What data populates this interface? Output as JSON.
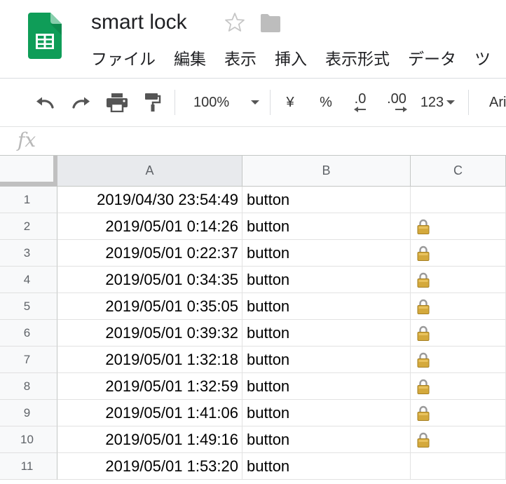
{
  "doc": {
    "title": "smart lock"
  },
  "header_icons": {
    "app": "google-sheets-icon",
    "star": "star-outline-icon",
    "folder": "folder-icon"
  },
  "menu": [
    "ファイル",
    "編集",
    "表示",
    "挿入",
    "表示形式",
    "データ",
    "ツ"
  ],
  "toolbar": {
    "zoom": "100%",
    "currency": "¥",
    "percent": "%",
    "decrease_decimal": ".0",
    "increase_decimal": ".00",
    "number_format": "123",
    "font": "Ari"
  },
  "formula_bar": {
    "fx_label": "fx",
    "value": ""
  },
  "columns": [
    "A",
    "B",
    "C"
  ],
  "rows": [
    {
      "num": "1",
      "a": "2019/04/30 23:54:49",
      "b": "button",
      "c_lock": false
    },
    {
      "num": "2",
      "a": "2019/05/01 0:14:26",
      "b": "button",
      "c_lock": true
    },
    {
      "num": "3",
      "a": "2019/05/01 0:22:37",
      "b": "button",
      "c_lock": true
    },
    {
      "num": "4",
      "a": "2019/05/01 0:34:35",
      "b": "button",
      "c_lock": true
    },
    {
      "num": "5",
      "a": "2019/05/01 0:35:05",
      "b": "button",
      "c_lock": true
    },
    {
      "num": "6",
      "a": "2019/05/01 0:39:32",
      "b": "button",
      "c_lock": true
    },
    {
      "num": "7",
      "a": "2019/05/01 1:32:18",
      "b": "button",
      "c_lock": true
    },
    {
      "num": "8",
      "a": "2019/05/01 1:32:59",
      "b": "button",
      "c_lock": true
    },
    {
      "num": "9",
      "a": "2019/05/01 1:41:06",
      "b": "button",
      "c_lock": true
    },
    {
      "num": "10",
      "a": "2019/05/01 1:49:16",
      "b": "button",
      "c_lock": true
    },
    {
      "num": "11",
      "a": "2019/05/01 1:53:20",
      "b": "button",
      "c_lock": false
    }
  ],
  "colors": {
    "sheets_green": "#0f9d58",
    "selected_column_header": "#e8eaed",
    "grid_line": "#e2e2e2",
    "lock_gold": "#d4a93c"
  }
}
